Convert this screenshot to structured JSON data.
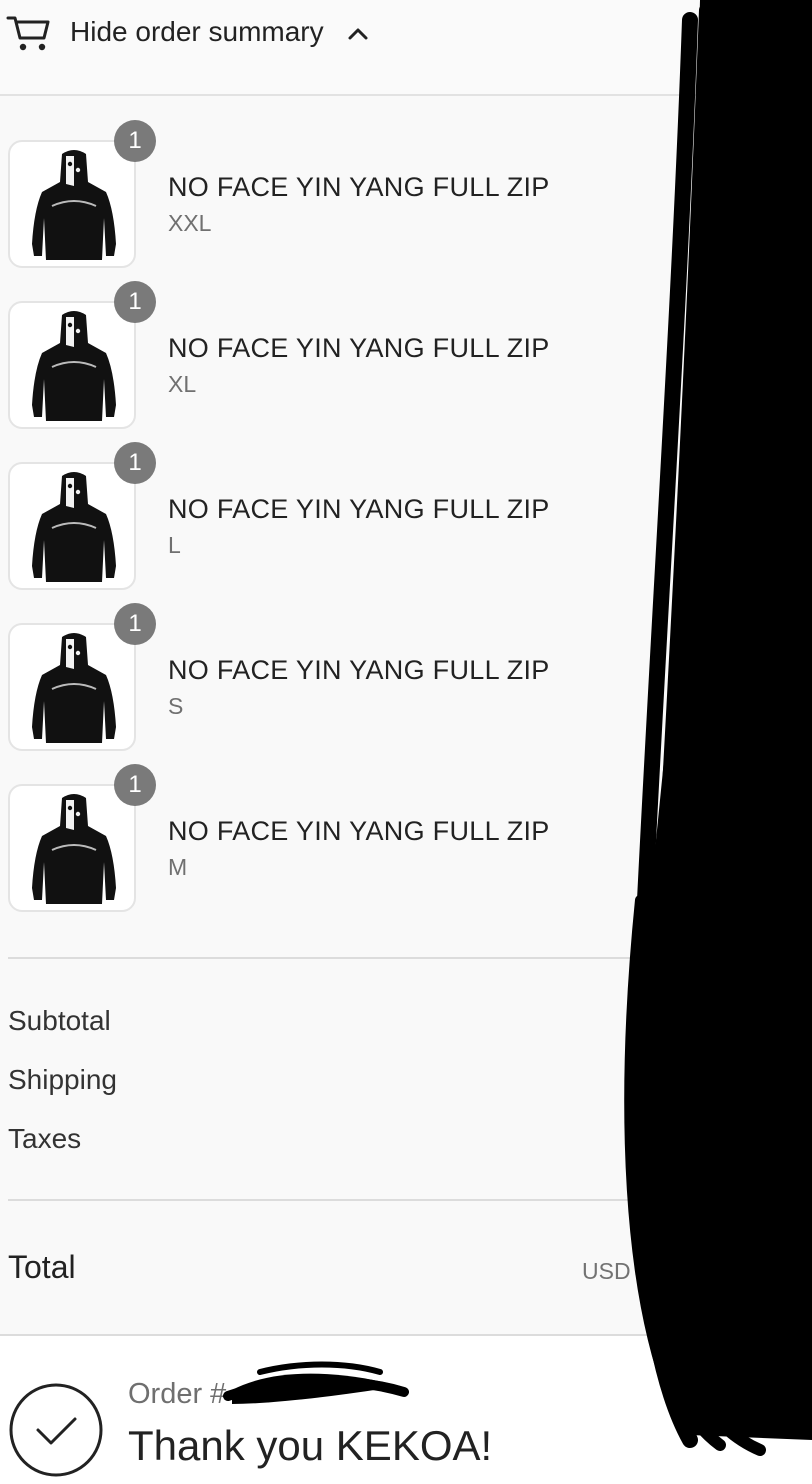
{
  "header": {
    "toggle_label": "Hide order summary",
    "cart_icon": "cart-icon",
    "chevron_icon": "chevron-up-icon"
  },
  "items": [
    {
      "name": "NO FACE YIN YANG FULL ZIP",
      "variant": "XXL",
      "quantity": "1"
    },
    {
      "name": "NO FACE YIN YANG FULL ZIP",
      "variant": "XL",
      "quantity": "1"
    },
    {
      "name": "NO FACE YIN YANG FULL ZIP",
      "variant": "L",
      "quantity": "1"
    },
    {
      "name": "NO FACE YIN YANG FULL ZIP",
      "variant": "S",
      "quantity": "1"
    },
    {
      "name": "NO FACE YIN YANG FULL ZIP",
      "variant": "M",
      "quantity": "1"
    }
  ],
  "costs": {
    "subtotal_label": "Subtotal",
    "shipping_label": "Shipping",
    "taxes_label": "Taxes"
  },
  "total": {
    "label": "Total",
    "currency": "USD"
  },
  "confirmation": {
    "order_prefix": "Order #",
    "thank_you": "Thank you KEKOA!",
    "icon": "checkmark-icon"
  },
  "colors": {
    "panel_bg": "#f9f9f9",
    "quantity_badge": "#7a7a7a",
    "redaction": "#000000"
  }
}
